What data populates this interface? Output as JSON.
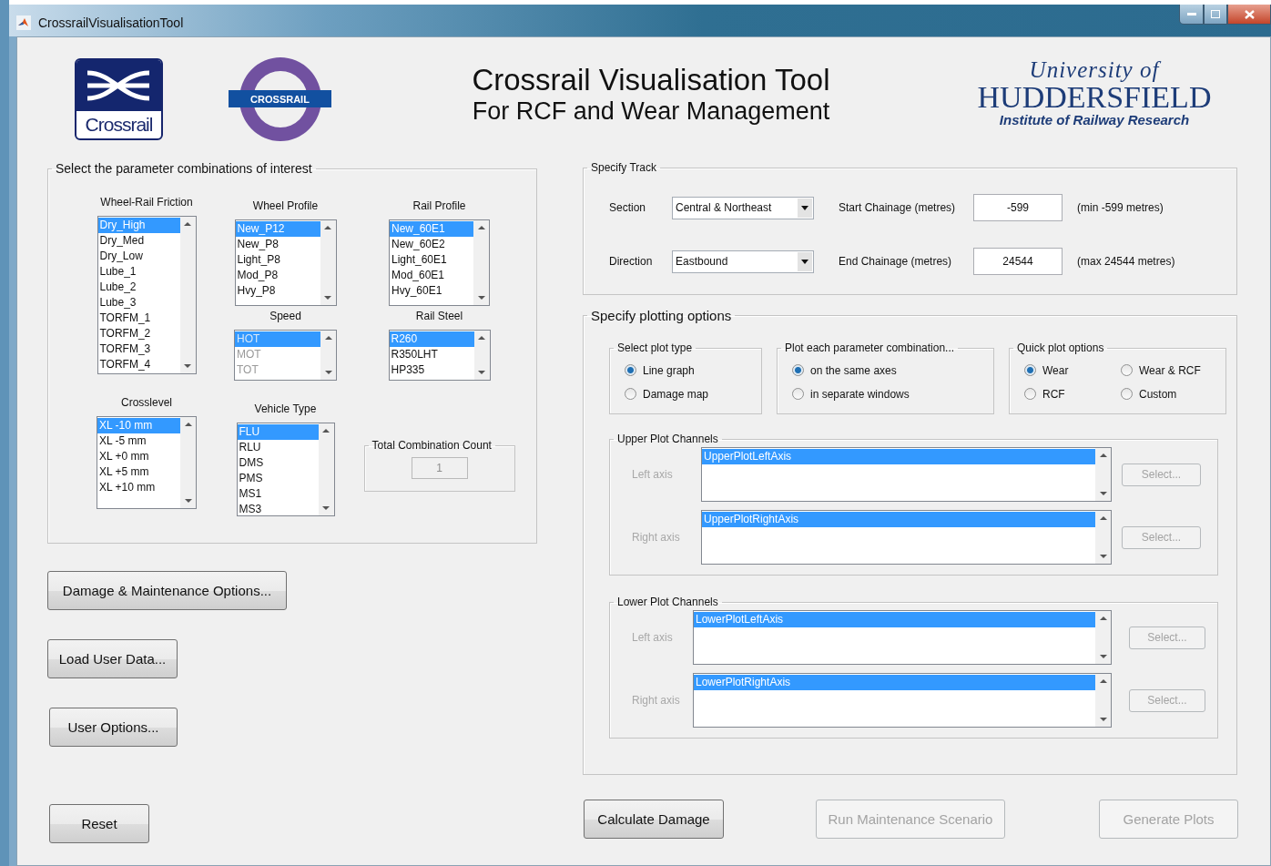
{
  "window": {
    "title": "CrossrailVisualisationTool"
  },
  "header": {
    "crossrail_logo": "Crossrail",
    "roundel": "CROSSRAIL",
    "title": "Crossrail Visualisation Tool",
    "subtitle": "For RCF and Wear Management",
    "university": {
      "line_1": "University of",
      "line_2": "HUDDERSFIELD",
      "line_3": "Institute of Railway Research"
    }
  },
  "parameters": {
    "title": "Select the parameter combinations of interest",
    "friction": {
      "label": "Wheel-Rail Friction",
      "disabled": false,
      "items": [
        {
          "text": "Dry_High",
          "selected": true
        },
        {
          "text": "Dry_Med",
          "selected": false
        },
        {
          "text": "Dry_Low",
          "selected": false
        },
        {
          "text": "Lube_1",
          "selected": false
        },
        {
          "text": "Lube_2",
          "selected": false
        },
        {
          "text": "Lube_3",
          "selected": false
        },
        {
          "text": "TORFM_1",
          "selected": false
        },
        {
          "text": "TORFM_2",
          "selected": false
        },
        {
          "text": "TORFM_3",
          "selected": false
        },
        {
          "text": "TORFM_4",
          "selected": false
        }
      ]
    },
    "wheel_profile": {
      "label": "Wheel Profile",
      "disabled": false,
      "items": [
        {
          "text": "New_P12",
          "selected": true
        },
        {
          "text": "New_P8",
          "selected": false
        },
        {
          "text": "Light_P8",
          "selected": false
        },
        {
          "text": "Mod_P8",
          "selected": false
        },
        {
          "text": "Hvy_P8",
          "selected": false
        }
      ]
    },
    "rail_profile": {
      "label": "Rail Profile",
      "disabled": false,
      "items": [
        {
          "text": "New_60E1",
          "selected": true
        },
        {
          "text": "New_60E2",
          "selected": false
        },
        {
          "text": "Light_60E1",
          "selected": false
        },
        {
          "text": "Mod_60E1",
          "selected": false
        },
        {
          "text": "Hvy_60E1",
          "selected": false
        }
      ]
    },
    "speed": {
      "label": "Speed",
      "disabled": true,
      "items": [
        {
          "text": "HOT",
          "selected": true
        },
        {
          "text": "MOT",
          "selected": false
        },
        {
          "text": "TOT",
          "selected": false
        }
      ]
    },
    "rail_steel": {
      "label": "Rail Steel",
      "disabled": false,
      "items": [
        {
          "text": "R260",
          "selected": true
        },
        {
          "text": "R350LHT",
          "selected": false
        },
        {
          "text": "HP335",
          "selected": false
        }
      ]
    },
    "crosslevel": {
      "label": "Crosslevel",
      "disabled": false,
      "items": [
        {
          "text": "XL -10 mm",
          "selected": true
        },
        {
          "text": "XL -5 mm",
          "selected": false
        },
        {
          "text": "XL +0 mm",
          "selected": false
        },
        {
          "text": "XL +5 mm",
          "selected": false
        },
        {
          "text": "XL +10 mm",
          "selected": false
        }
      ]
    },
    "vehicle_type": {
      "label": "Vehicle Type",
      "disabled": false,
      "items": [
        {
          "text": "FLU",
          "selected": true
        },
        {
          "text": "RLU",
          "selected": false
        },
        {
          "text": "DMS",
          "selected": false
        },
        {
          "text": "PMS",
          "selected": false
        },
        {
          "text": "MS1",
          "selected": false
        },
        {
          "text": "MS3",
          "selected": false
        }
      ]
    },
    "total": {
      "label": "Total Combination Count",
      "value": "1"
    }
  },
  "side_buttons": [
    {
      "label": "Damage & Maintenance Options..."
    },
    {
      "label": "Load User Data..."
    },
    {
      "label": "User Options..."
    }
  ],
  "reset_button": {
    "label": "Reset"
  },
  "track": {
    "title": "Specify Track",
    "rows": [
      {
        "label": "Section",
        "dropdown": "Central & Northeast",
        "chainage_label": "Start Chainage (metres)",
        "chainage": "-599",
        "limit": "(min -599 metres)"
      },
      {
        "label": "Direction",
        "dropdown": "Eastbound",
        "chainage_label": "End Chainage (metres)",
        "chainage": "24544",
        "limit": "(max 24544 metres)"
      }
    ]
  },
  "plotting": {
    "title": "Specify plotting options",
    "groups": [
      {
        "title": "Select plot type",
        "options": [
          {
            "label": "Line graph",
            "selected": true
          },
          {
            "label": "Damage map",
            "selected": false
          }
        ]
      },
      {
        "title": "Plot each parameter combination...",
        "options": [
          {
            "label": "on the same axes",
            "selected": true
          },
          {
            "label": "in separate windows",
            "selected": false
          }
        ]
      },
      {
        "title": "Quick plot options",
        "options": [
          {
            "label": "Wear",
            "selected": true
          },
          {
            "label": "Wear & RCF",
            "selected": false
          },
          {
            "label": "RCF",
            "selected": false
          },
          {
            "label": "Custom",
            "selected": false
          }
        ]
      }
    ],
    "channels": [
      {
        "title": "Upper Plot Channels",
        "axes": [
          {
            "label": "Left axis",
            "disabled": true,
            "items": [
              {
                "text": "UpperPlotLeftAxis",
                "selected": true
              }
            ],
            "button": "Select..."
          },
          {
            "label": "Right axis",
            "disabled": true,
            "items": [
              {
                "text": "UpperPlotRightAxis",
                "selected": true
              }
            ],
            "button": "Select..."
          }
        ]
      },
      {
        "title": "Lower Plot Channels",
        "axes": [
          {
            "label": "Left axis",
            "disabled": true,
            "items": [
              {
                "text": "LowerPlotLeftAxis",
                "selected": true
              }
            ],
            "button": "Select..."
          },
          {
            "label": "Right axis",
            "disabled": true,
            "items": [
              {
                "text": "LowerPlotRightAxis",
                "selected": true
              }
            ],
            "button": "Select..."
          }
        ]
      }
    ]
  },
  "bottom_buttons": [
    {
      "label": "Calculate Damage",
      "disabled": false
    },
    {
      "label": "Run Maintenance Scenario",
      "disabled": true
    },
    {
      "label": "Generate Plots",
      "disabled": true
    }
  ]
}
